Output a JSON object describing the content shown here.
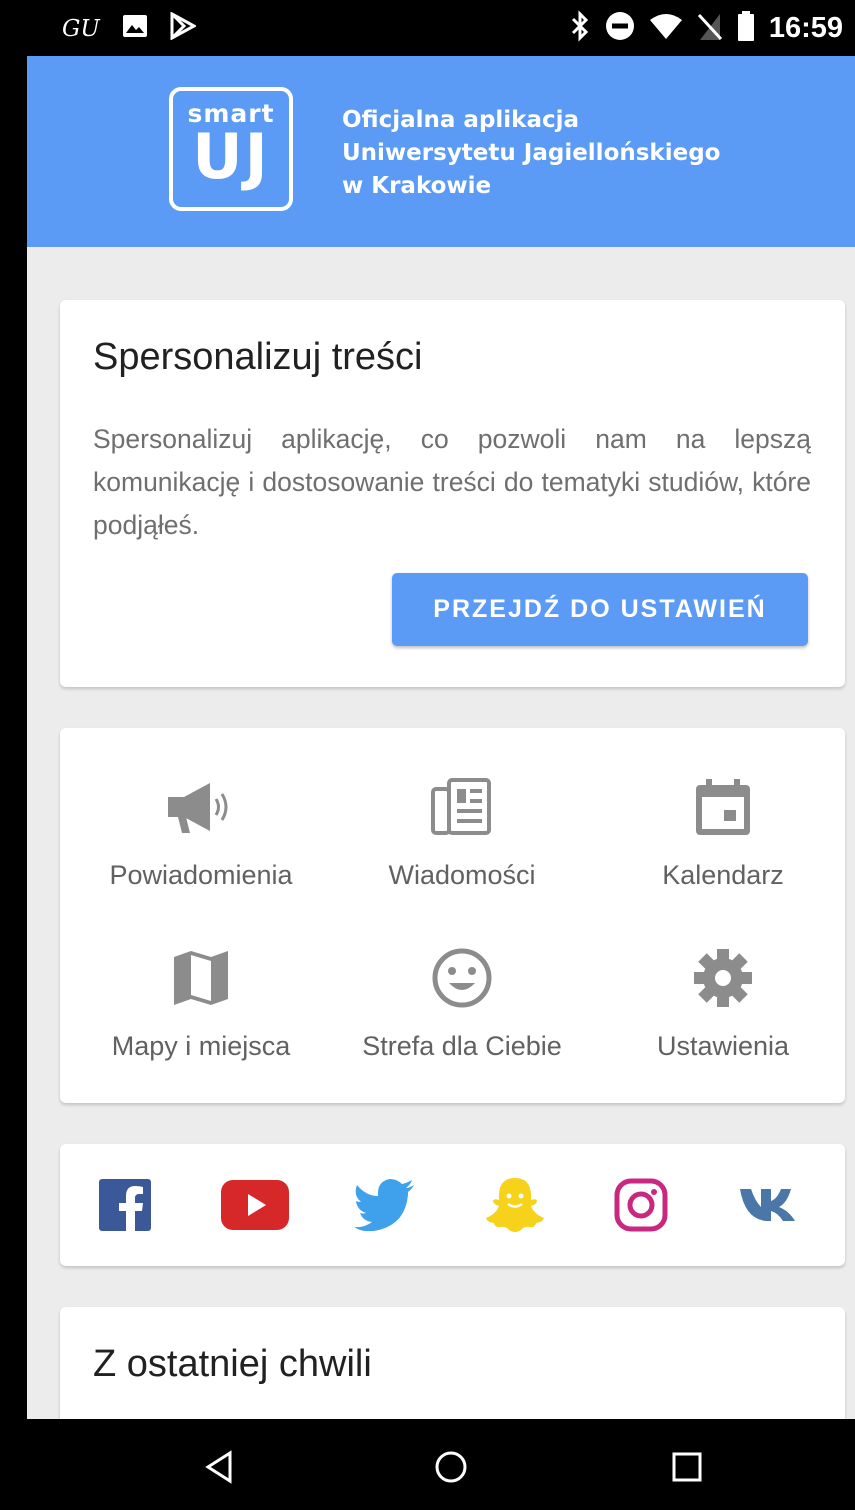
{
  "status_bar": {
    "carrier": "GU",
    "time": "16:59",
    "icons": [
      "image-icon",
      "play-store-icon",
      "bluetooth-icon",
      "do-not-disturb-icon",
      "wifi-icon",
      "no-sim-icon",
      "battery-icon"
    ]
  },
  "header": {
    "logo_top": "smart",
    "logo_bottom": "UJ",
    "tagline": [
      "Oficjalna aplikacja",
      "Uniwersytetu Jagiellońskiego",
      "w Krakowie"
    ],
    "background_color": "#5b9bf5"
  },
  "personalize_card": {
    "title": "Spersonalizuj treści",
    "body": "Spersonalizuj aplikację, co pozwoli nam na lepszą komunikację i dostosowanie treści do tematyki studiów, które podjąłeś.",
    "button_label": "PRZEJDŹ DO USTAWIEŃ"
  },
  "menu": {
    "items": [
      {
        "label": "Powiadomienia",
        "icon": "megaphone-icon"
      },
      {
        "label": "Wiadomości",
        "icon": "newspaper-icon"
      },
      {
        "label": "Kalendarz",
        "icon": "calendar-icon"
      },
      {
        "label": "Mapy i miejsca",
        "icon": "map-icon"
      },
      {
        "label": "Strefa dla Ciebie",
        "icon": "smiley-icon"
      },
      {
        "label": "Ustawienia",
        "icon": "gear-icon"
      }
    ],
    "icon_color": "#8c8c8c"
  },
  "social": {
    "items": [
      {
        "name": "facebook",
        "color": "#3b5998"
      },
      {
        "name": "youtube",
        "color": "#d62828"
      },
      {
        "name": "twitter",
        "color": "#3fa1ec"
      },
      {
        "name": "snapchat",
        "color": "#f7d21b"
      },
      {
        "name": "instagram",
        "color": "#c8287f"
      },
      {
        "name": "vk",
        "color": "#4a76a8"
      }
    ]
  },
  "latest": {
    "title": "Z ostatniej chwili"
  },
  "nav_bar": {
    "buttons": [
      "back-icon",
      "home-icon",
      "recents-icon"
    ]
  }
}
